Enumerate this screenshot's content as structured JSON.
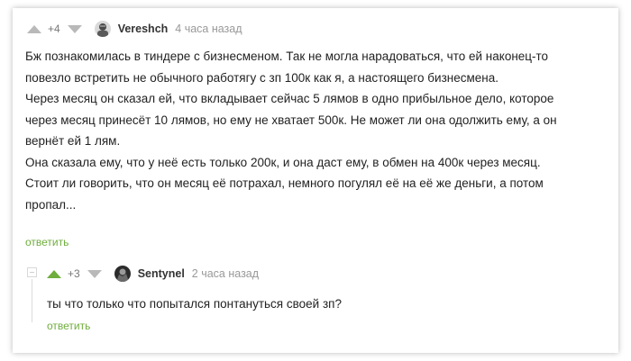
{
  "comment1": {
    "rating": "+4",
    "author": "Vereshch",
    "time": "4 часа назад",
    "text": [
      "Бж познакомилась в тиндере с бизнесменом. Так не могла нарадоваться, что ей наконец-то",
      "повезло встретить не обычного работягу с зп 100к как я, а настоящего бизнесмена.",
      "Через месяц он сказал ей, что вкладывает сейчас 5 лямов в одно прибыльное дело, которое",
      "через месяц принесёт 10 лямов, но ему не хватает 500к. Не может ли она одолжить ему, а он",
      "вернёт ей 1 лям.",
      "Она сказала ему, что у неё есть только 200к, и она даст ему, в обмен на 400к через месяц.",
      "Стоит ли говорить, что он месяц её потрахал, немного погулял её на её же деньги, а потом",
      "пропал..."
    ],
    "reply_label": "ответить"
  },
  "comment2": {
    "rating": "+3",
    "author": "Sentynel",
    "time": "2 часа назад",
    "text": "ты что только что попытался понтануться своей зп?",
    "reply_label": "ответить"
  },
  "colors": {
    "accent_green": "#6fae3c",
    "arrow_gray": "#b9b9b9"
  }
}
